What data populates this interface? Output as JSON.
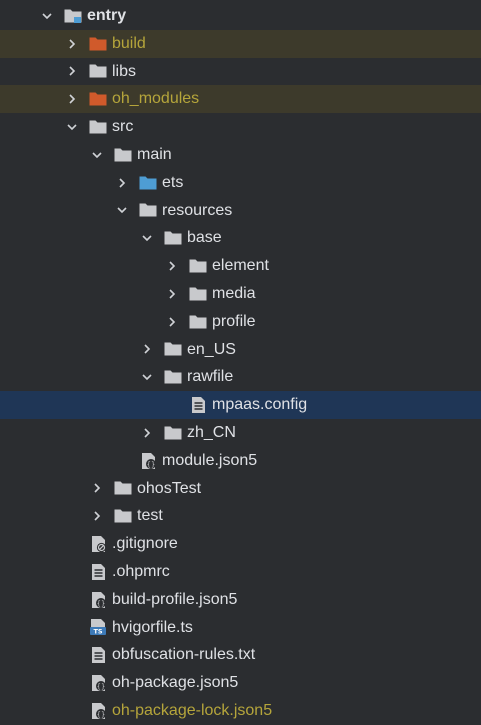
{
  "tree": [
    {
      "label": "entry",
      "depth": 0,
      "expander": "expanded",
      "icon": "module-folder-icon",
      "bold": true
    },
    {
      "label": "build",
      "depth": 1,
      "expander": "collapsed",
      "icon": "excluded-folder-icon",
      "status": "excluded"
    },
    {
      "label": "libs",
      "depth": 1,
      "expander": "collapsed",
      "icon": "folder-icon"
    },
    {
      "label": "oh_modules",
      "depth": 1,
      "expander": "collapsed",
      "icon": "excluded-folder-icon",
      "status": "excluded"
    },
    {
      "label": "src",
      "depth": 1,
      "expander": "expanded",
      "icon": "folder-icon"
    },
    {
      "label": "main",
      "depth": 2,
      "expander": "expanded",
      "icon": "folder-icon"
    },
    {
      "label": "ets",
      "depth": 3,
      "expander": "collapsed",
      "icon": "source-folder-icon"
    },
    {
      "label": "resources",
      "depth": 3,
      "expander": "expanded",
      "icon": "folder-icon"
    },
    {
      "label": "base",
      "depth": 4,
      "expander": "expanded",
      "icon": "folder-icon"
    },
    {
      "label": "element",
      "depth": 5,
      "expander": "collapsed",
      "icon": "folder-icon"
    },
    {
      "label": "media",
      "depth": 5,
      "expander": "collapsed",
      "icon": "folder-icon"
    },
    {
      "label": "profile",
      "depth": 5,
      "expander": "collapsed",
      "icon": "folder-icon"
    },
    {
      "label": "en_US",
      "depth": 4,
      "expander": "collapsed",
      "icon": "folder-icon"
    },
    {
      "label": "rawfile",
      "depth": 4,
      "expander": "expanded",
      "icon": "folder-icon"
    },
    {
      "label": "mpaas.config",
      "depth": 5,
      "expander": "none",
      "icon": "text-file-icon",
      "status": "selected"
    },
    {
      "label": "zh_CN",
      "depth": 4,
      "expander": "collapsed",
      "icon": "folder-icon"
    },
    {
      "label": "module.json5",
      "depth": 3,
      "expander": "none",
      "icon": "json5-file-icon"
    },
    {
      "label": "ohosTest",
      "depth": 2,
      "expander": "collapsed",
      "icon": "folder-icon"
    },
    {
      "label": "test",
      "depth": 2,
      "expander": "collapsed",
      "icon": "folder-icon"
    },
    {
      "label": ".gitignore",
      "depth": 1,
      "expander": "none",
      "icon": "ignore-file-icon"
    },
    {
      "label": ".ohpmrc",
      "depth": 1,
      "expander": "none",
      "icon": "text-file-icon"
    },
    {
      "label": "build-profile.json5",
      "depth": 1,
      "expander": "none",
      "icon": "json5-file-icon"
    },
    {
      "label": "hvigorfile.ts",
      "depth": 1,
      "expander": "none",
      "icon": "ts-file-icon"
    },
    {
      "label": "obfuscation-rules.txt",
      "depth": 1,
      "expander": "none",
      "icon": "text-file-icon"
    },
    {
      "label": "oh-package.json5",
      "depth": 1,
      "expander": "none",
      "icon": "json5-file-icon"
    },
    {
      "label": "oh-package-lock.json5",
      "depth": 1,
      "expander": "none",
      "icon": "json5-file-icon",
      "muted": true
    }
  ],
  "colors": {
    "background": "#2b2d30",
    "text": "#dfe1e5",
    "excluded_text": "#b5a53b",
    "excluded_row": "#3d3a2b",
    "selected_row": "#1f3656",
    "folder": "#c8c9cc",
    "excluded_folder": "#d05a2b",
    "source_folder": "#4e9dd4",
    "ts_badge": "#3d7ab8"
  }
}
